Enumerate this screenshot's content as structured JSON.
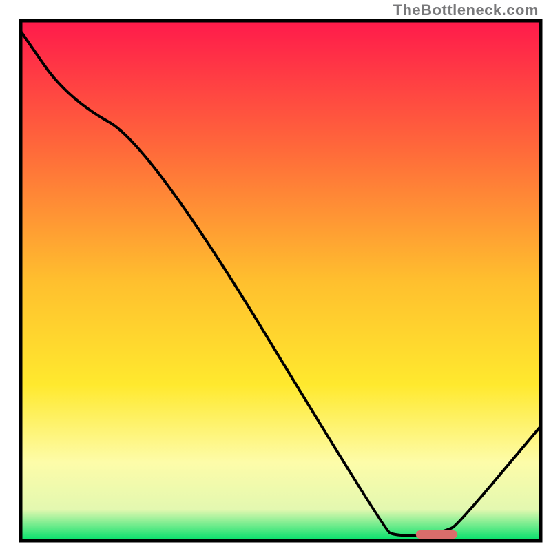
{
  "attribution": "TheBottleneck.com",
  "chart_data": {
    "type": "line",
    "title": "",
    "xlabel": "",
    "ylabel": "",
    "x_range": [
      0,
      100
    ],
    "y_range": [
      0,
      100
    ],
    "series": [
      {
        "name": "curve",
        "x": [
          0,
          9,
          25,
          70,
          72,
          78,
          82,
          84,
          100
        ],
        "y": [
          98,
          85,
          76,
          2,
          1,
          1,
          2,
          3,
          22
        ]
      }
    ],
    "flat_segment": {
      "x_start": 72,
      "x_end": 84,
      "y": 1.2
    },
    "marker": {
      "x_start": 76,
      "x_end": 84,
      "y": 1.2,
      "color": "#da6d6b"
    },
    "gradient_stops": [
      {
        "offset": 0.0,
        "color": "#ff1a4b"
      },
      {
        "offset": 0.25,
        "color": "#ff6a3a"
      },
      {
        "offset": 0.5,
        "color": "#ffbf2e"
      },
      {
        "offset": 0.7,
        "color": "#ffe92e"
      },
      {
        "offset": 0.85,
        "color": "#fdfca9"
      },
      {
        "offset": 0.94,
        "color": "#e3f8b0"
      },
      {
        "offset": 1.0,
        "color": "#00e06a"
      }
    ],
    "colors": {
      "curve": "#000000",
      "border": "#000000",
      "marker": "#da6d6b"
    }
  }
}
